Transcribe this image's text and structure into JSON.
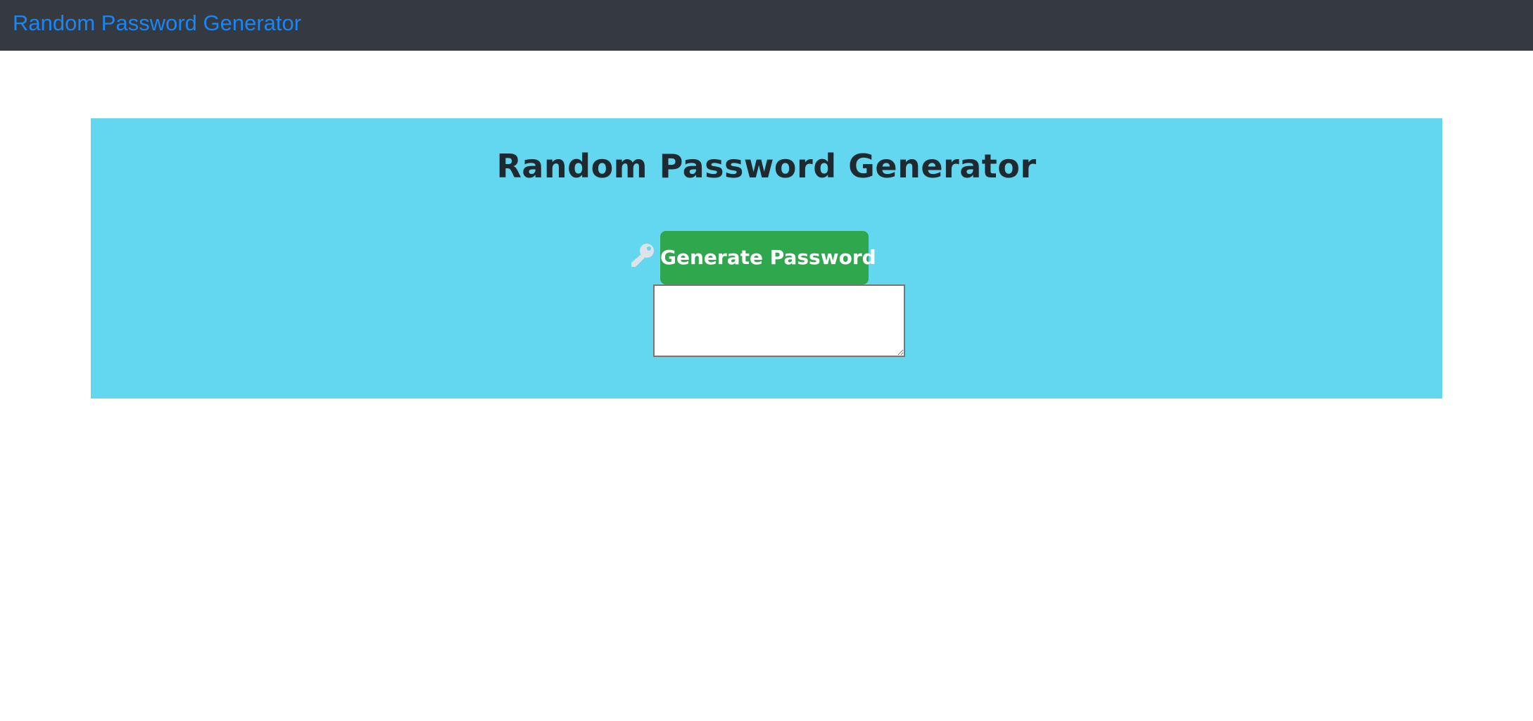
{
  "navbar": {
    "brand": "Random Password Generator"
  },
  "jumbotron": {
    "title": "Random Password Generator",
    "generate_button_label": "Generate Password",
    "password_output": {
      "value": "",
      "placeholder": ""
    }
  },
  "icons": {
    "key": "key-icon"
  },
  "colors": {
    "navbar_bg": "#343a40",
    "brand": "#1a85f5",
    "jumbotron_bg": "#63d7f0",
    "button_bg": "#2ea74d",
    "button_text": "#ffffff",
    "title_text": "#1f2a30",
    "key_icon": "#dde3e6"
  }
}
